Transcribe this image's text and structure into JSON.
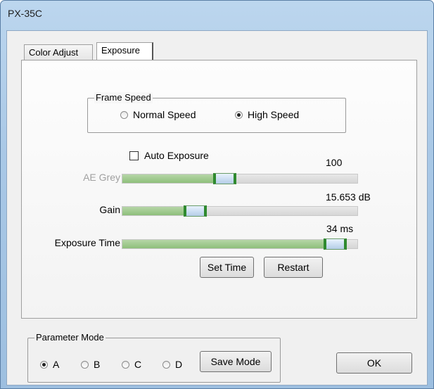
{
  "window": {
    "title": "PX-35C"
  },
  "tabs": [
    {
      "label": "Color Adjust"
    },
    {
      "label": "Exposure"
    }
  ],
  "frame_speed": {
    "legend": "Frame Speed",
    "options": [
      {
        "label": "Normal Speed",
        "selected": false
      },
      {
        "label": "High Speed",
        "selected": true
      }
    ]
  },
  "auto_exposure": {
    "label": "Auto Exposure",
    "checked": false
  },
  "sliders": {
    "ae_grey": {
      "label": "AE Grey",
      "value": "100",
      "fraction": 0.43,
      "enabled": false
    },
    "gain": {
      "label": "Gain",
      "value": "15.653 dB",
      "fraction": 0.29,
      "enabled": true
    },
    "exposure_time": {
      "label": "Exposure Time",
      "value": "34 ms",
      "fraction": 0.95,
      "enabled": true
    }
  },
  "buttons": {
    "set_time": "Set Time",
    "restart": "Restart",
    "save_mode": "Save Mode",
    "ok": "OK"
  },
  "parameter_mode": {
    "legend": "Parameter Mode",
    "options": [
      {
        "label": "A",
        "selected": true
      },
      {
        "label": "B",
        "selected": false
      },
      {
        "label": "C",
        "selected": false
      },
      {
        "label": "D",
        "selected": false
      }
    ]
  }
}
